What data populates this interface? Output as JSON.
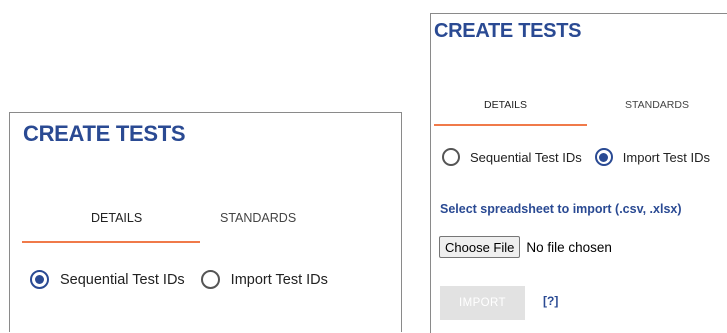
{
  "left_panel": {
    "title": "CREATE TESTS",
    "tabs": [
      {
        "label": "DETAILS",
        "active": true
      },
      {
        "label": "STANDARDS",
        "active": false
      }
    ],
    "radio_options": [
      {
        "label": "Sequential Test IDs",
        "checked": true
      },
      {
        "label": "Import Test IDs",
        "checked": false
      }
    ]
  },
  "right_panel": {
    "title": "CREATE TESTS",
    "tabs": [
      {
        "label": "DETAILS",
        "active": true
      },
      {
        "label": "STANDARDS",
        "active": false
      }
    ],
    "radio_options": [
      {
        "label": "Sequential Test IDs",
        "checked": false
      },
      {
        "label": "Import Test IDs",
        "checked": true
      }
    ],
    "select_label": "Select spreadsheet to import (.csv, .xlsx)",
    "file_input": {
      "button_label": "Choose File",
      "status": "No file chosen"
    },
    "import_button": "IMPORT",
    "help_link": "[?]"
  },
  "colors": {
    "title": "#2a4a93",
    "tab_underline": "#f07a4a",
    "radio_checked": "#2a4a93",
    "import_disabled": "#e2e2e2"
  }
}
